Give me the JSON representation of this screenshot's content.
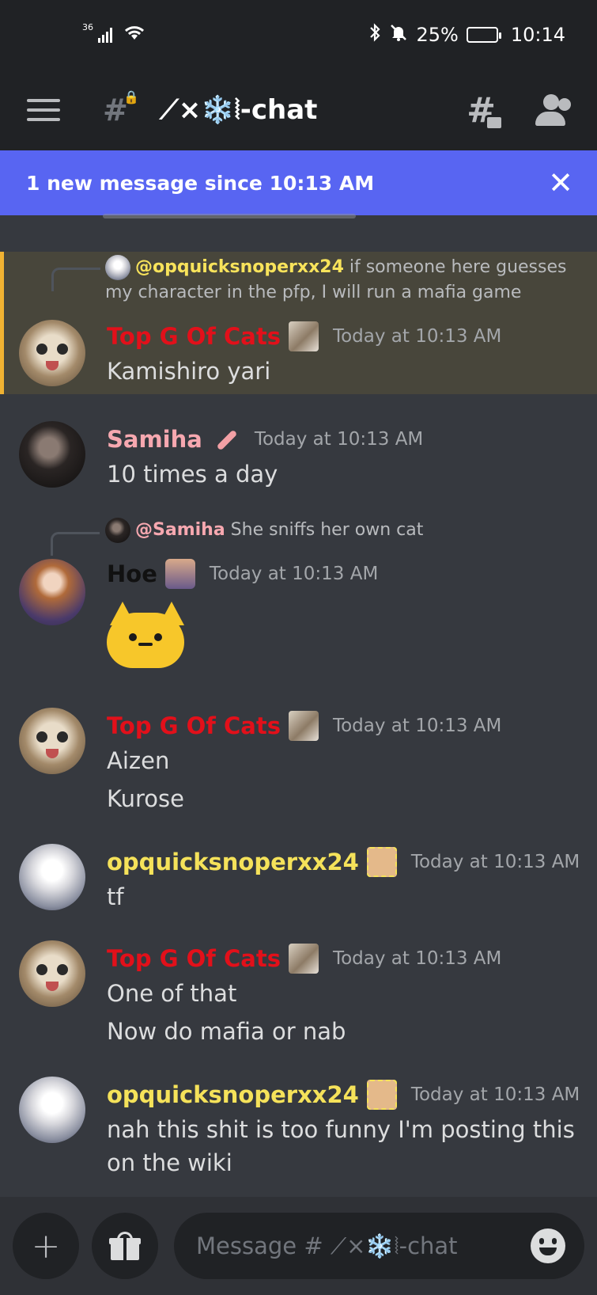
{
  "status_bar": {
    "signal": "36",
    "battery_percent": "25%",
    "battery_level": 0.25,
    "time": "10:14"
  },
  "header": {
    "channel_name": "⟋×❄️⦚-chat",
    "menu_icon": "hamburger-icon",
    "channel_icon": "locked-hash-icon",
    "threads_icon": "threads-icon",
    "members_icon": "members-icon"
  },
  "new_messages_bar": {
    "text": "1 new message since 10:13 AM",
    "close": "✕"
  },
  "messages": [
    {
      "reply": {
        "mention": "@opquicksnoperxx24",
        "text": " if someone here guesses my character in the pfp, I will run a mafia game"
      },
      "author": "Top G Of Cats",
      "timestamp": "Today at 10:13 AM",
      "lines": [
        "Kamishiro yari"
      ],
      "highlighted": true
    },
    {
      "author": "Samiha",
      "timestamp": "Today at 10:13 AM",
      "lines": [
        "10 times a day"
      ]
    },
    {
      "reply": {
        "mention": "@Samiha",
        "text": " She sniffs her own cat"
      },
      "author": "Hoe",
      "timestamp": "Today at 10:13 AM",
      "emoji": "cat-emoji"
    },
    {
      "author": "Top G Of Cats",
      "timestamp": "Today at 10:13 AM",
      "lines": [
        "Aizen",
        "Kurose"
      ]
    },
    {
      "author": "opquicksnoperxx24",
      "timestamp": "Today at 10:13 AM",
      "lines": [
        "tf"
      ]
    },
    {
      "author": "Top G Of Cats",
      "timestamp": "Today at 10:13 AM",
      "lines": [
        "One of that",
        "Now do mafia or nab"
      ]
    },
    {
      "author": "opquicksnoperxx24",
      "timestamp": "Today at 10:13 AM",
      "lines": [
        "nah this shit is too funny I'm posting this",
        "on the wiki"
      ]
    }
  ],
  "composer": {
    "placeholder": "Message # ⟋×❄️⦚-chat",
    "add_icon": "plus-icon",
    "gift_icon": "gift-icon",
    "emoji_icon": "smile-icon"
  },
  "colors": {
    "accent": "#5865f2",
    "highlight_bar": "#f0b232",
    "name_red": "#e2101a",
    "name_yellow": "#f5e25a",
    "name_pink": "#f7a8b0"
  }
}
